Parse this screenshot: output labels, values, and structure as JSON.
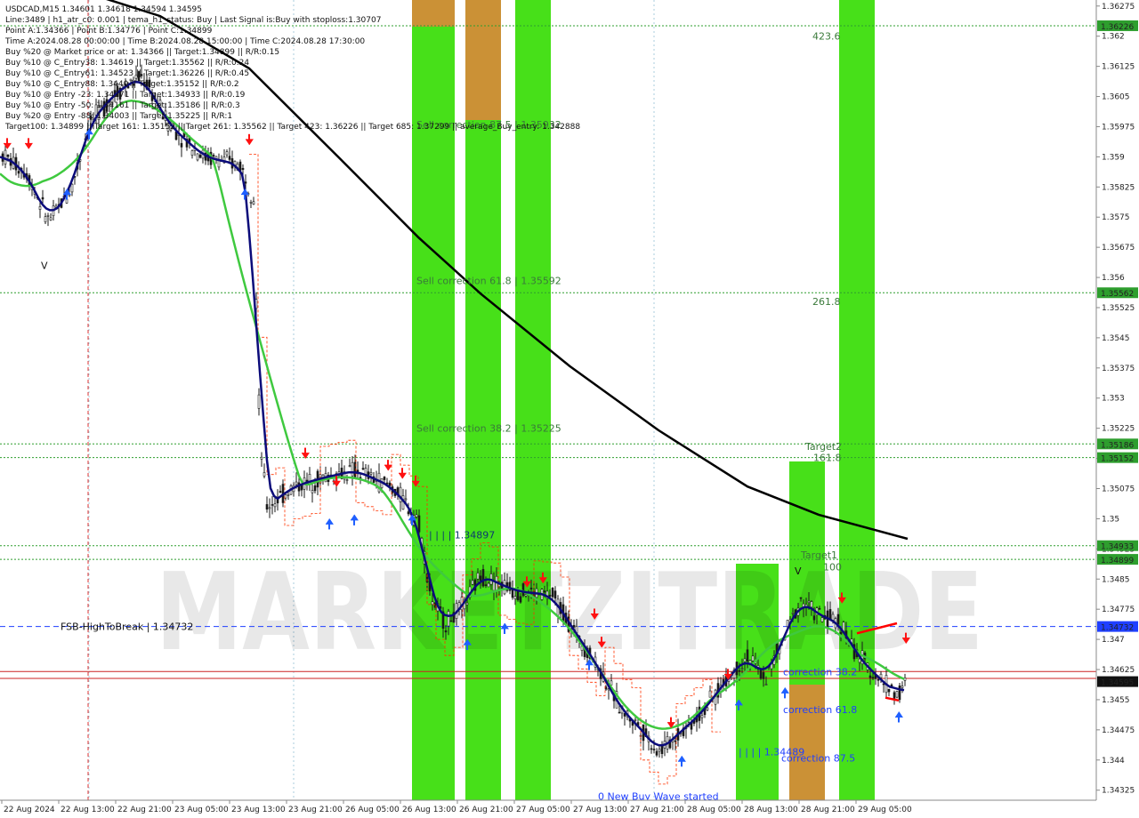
{
  "chart_data": {
    "type": "candlestick",
    "symbol": "USDCAD",
    "info_lines": [
      "USDCAD,M15  1.34601 1.34618 1.34594 1.34595",
      "Line:3489 | h1_atr_c0: 0.001 | tema_h1_status: Buy | Last Signal is:Buy with stoploss:1.30707",
      "Point A:1.34366 | Point B:1.34776 | Point C:1.34899",
      "Time A:2024.08.28 00:00:00 | Time B:2024.08.28 15:00:00 | Time C:2024.08.28 17:30:00",
      "Buy %20 @ Market price or at: 1.34366 || Target:1.34899 || R/R:0.15",
      "Buy %10 @ C_Entry38: 1.34619 || Target:1.35562 || R/R:0.24",
      "Buy %10 @ C_Entry61: 1.34523 || Target:1.36226 || R/R:0.45",
      "Buy %10 @ C_Entry88: 1.3440 || Target:1.35152 || R/R:0.2",
      "Buy %10 @ Entry -23: 1.34271 || Target:1.34933 || R/R:0.19",
      "Buy %10 @ Entry -50: 1.34161 || Target:1.35186 || R/R:0.3",
      "Buy %20 @ Entry -88: 1.34003 || Target:1.35225 || R/R:1",
      "Target100: 1.34899 || Target 161: 1.35152 || Target 261: 1.35562 || Target 423: 1.36226 || Target 685: 1.37299 || average_Buy_entry: 1.342888"
    ],
    "x_ticks": [
      "22 Aug 2024",
      "22 Aug 13:00",
      "22 Aug 21:00",
      "23 Aug 05:00",
      "23 Aug 13:00",
      "23 Aug 21:00",
      "26 Aug 05:00",
      "26 Aug 13:00",
      "26 Aug 21:00",
      "27 Aug 05:00",
      "27 Aug 13:00",
      "27 Aug 21:00",
      "28 Aug 05:00",
      "28 Aug 13:00",
      "28 Aug 21:00",
      "29 Aug 05:00"
    ],
    "y_ticks": [
      1.36275,
      1.362,
      1.36125,
      1.3605,
      1.35975,
      1.359,
      1.35825,
      1.3575,
      1.35675,
      1.356,
      1.35525,
      1.3545,
      1.35375,
      1.353,
      1.35225,
      1.3515,
      1.35075,
      1.35,
      1.34925,
      1.3485,
      1.34775,
      1.347,
      1.34625,
      1.3455,
      1.34475,
      1.344,
      1.34325
    ],
    "y_range": [
      1.343,
      1.3629
    ],
    "price_tags": [
      {
        "label": "1.36226",
        "value": 1.36226,
        "color": "#2e9e2e"
      },
      {
        "label": "1.35562",
        "value": 1.35562,
        "color": "#2e9e2e"
      },
      {
        "label": "1.35186",
        "value": 1.35186,
        "color": "#2e9e2e"
      },
      {
        "label": "1.35152",
        "value": 1.35152,
        "color": "#2e9e2e"
      },
      {
        "label": "1.34933",
        "value": 1.34933,
        "color": "#2e9e2e"
      },
      {
        "label": "1.34899",
        "value": 1.34899,
        "color": "#2e9e2e"
      },
      {
        "label": "1.34732",
        "value": 1.34732,
        "color": "#1f3fff"
      },
      {
        "label": "1.34595",
        "value": 1.34595,
        "color": "#111111"
      }
    ],
    "horizontal_levels": [
      {
        "value": 1.36226,
        "style": "dotted",
        "color": "#2e9e2e"
      },
      {
        "value": 1.35562,
        "style": "dotted",
        "color": "#2e9e2e"
      },
      {
        "value": 1.35186,
        "style": "dotted",
        "color": "#2e9e2e"
      },
      {
        "value": 1.35152,
        "style": "dotted",
        "color": "#2e9e2e"
      },
      {
        "value": 1.34933,
        "style": "dotted",
        "color": "#2e9e2e"
      },
      {
        "value": 1.34899,
        "style": "dotted",
        "color": "#2e9e2e"
      },
      {
        "value": 1.34732,
        "style": "dashed",
        "color": "#1f3fff"
      },
      {
        "value": 1.3462,
        "style": "solid",
        "color": "#cc2222"
      },
      {
        "value": 1.34603,
        "style": "solid",
        "color": "#cc2222"
      }
    ],
    "annotations": [
      {
        "text": "423.6",
        "value": 1.362,
        "color": "#3a7a3a"
      },
      {
        "text": "261.8",
        "value": 1.3554,
        "color": "#3a7a3a"
      },
      {
        "text": "Target2",
        "value": 1.3518,
        "color": "#3a7a3a"
      },
      {
        "text": "161.8",
        "value": 1.35152,
        "color": "#3a7a3a"
      },
      {
        "text": "Target1",
        "value": 1.3491,
        "color": "#3a7a3a"
      },
      {
        "text": "100",
        "value": 1.3488,
        "color": "#3a7a3a"
      },
      {
        "text": "Sell correction 87.5 | 1.35932",
        "value": 1.3598,
        "color": "#3a7a3a"
      },
      {
        "text": "Sell correction 61.8 | 1.35592",
        "value": 1.35592,
        "color": "#3a7a3a"
      },
      {
        "text": "Sell correction 38.2 | 1.35225",
        "value": 1.35225,
        "color": "#3a7a3a"
      },
      {
        "text": "| | | | 1.34897",
        "value": 1.3496,
        "color": "#0c3a6e"
      },
      {
        "text": "| | | | 1.34489",
        "value": 1.3442,
        "color": "#1f3fff"
      },
      {
        "text": "correction 38.2",
        "value": 1.3462,
        "color": "#1f3fff"
      },
      {
        "text": "correction 61.8",
        "value": 1.34525,
        "color": "#1f3fff"
      },
      {
        "text": "correction 87.5",
        "value": 1.34405,
        "color": "#1f3fff"
      },
      {
        "text": "FSB-HighToBreak | 1.34732",
        "value": 1.34732,
        "color": "#111111"
      },
      {
        "text": "0 New Buy Wave started",
        "value": 1.3431,
        "color": "#1f3fff"
      },
      {
        "text": "V",
        "value": 1.3563,
        "color": "#111111"
      },
      {
        "text": "V",
        "value": 1.3487,
        "color": "#111111"
      }
    ],
    "watermark": "MARKETZITRADE",
    "colors": {
      "green_zone": "#33dd00",
      "orange_zone": "#d9883a",
      "fast_ma": "#0b0b7a",
      "slow_ma": "#3fc93f",
      "long_ma": "#000000",
      "stoploss": "#ff3300",
      "buy_arrow": "#1f5fff",
      "sell_arrow": "#ff1111",
      "bull_candle": "#1a1a1a",
      "bear_candle": "#1a1a1a"
    },
    "grid": true
  }
}
